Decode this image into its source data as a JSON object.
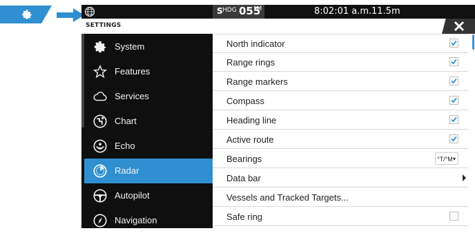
{
  "topbar": {
    "hdg_direction": "S",
    "hdg_label": "HDG",
    "hdg_value": "055",
    "hdg_unit": "°M",
    "time": "8:02:01 a.m.",
    "depth": "11.5m"
  },
  "settings": {
    "title": "SETTINGS"
  },
  "sidebar": {
    "items": [
      {
        "label": "System",
        "icon": "gear-icon"
      },
      {
        "label": "Features",
        "icon": "star-icon"
      },
      {
        "label": "Services",
        "icon": "cloud-icon"
      },
      {
        "label": "Chart",
        "icon": "chart-icon"
      },
      {
        "label": "Echo",
        "icon": "echo-icon"
      },
      {
        "label": "Radar",
        "icon": "radar-icon",
        "active": true
      },
      {
        "label": "Autopilot",
        "icon": "steering-wheel-icon"
      },
      {
        "label": "Navigation",
        "icon": "compass-icon"
      }
    ]
  },
  "list": {
    "rows": [
      {
        "label": "North indicator",
        "checked": true
      },
      {
        "label": "Range rings",
        "checked": true
      },
      {
        "label": "Range markers",
        "checked": true
      },
      {
        "label": "Compass",
        "checked": true
      },
      {
        "label": "Heading line",
        "checked": true
      },
      {
        "label": "Active route",
        "checked": true
      },
      {
        "label": "Bearings",
        "value": "°T/°M"
      },
      {
        "label": "Data bar"
      },
      {
        "label": "Vessels and Tracked Targets..."
      },
      {
        "label": "Safe ring",
        "checked": false
      }
    ]
  },
  "colors": {
    "accent": "#2f8fd0",
    "sidebar_bg": "#0f0f0f",
    "topbar_bg": "#111111"
  }
}
